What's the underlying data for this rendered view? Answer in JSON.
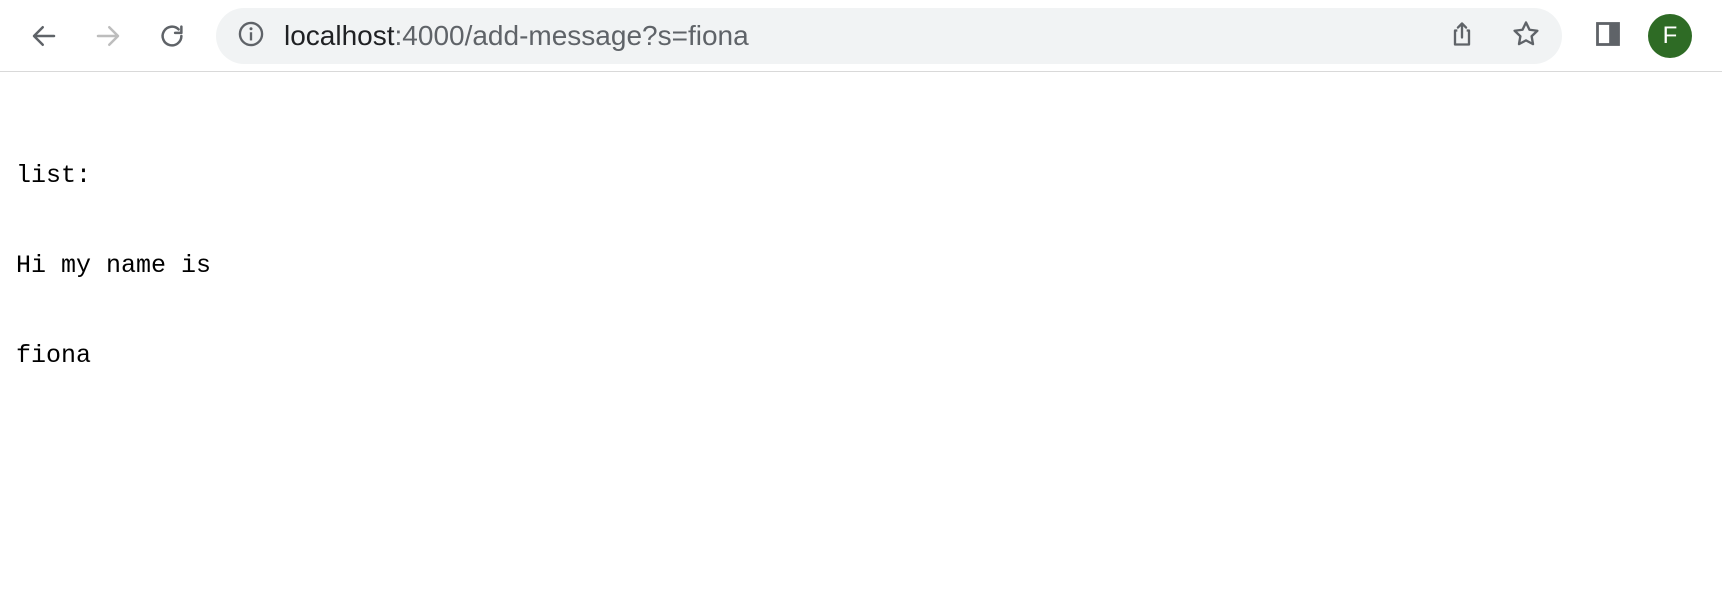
{
  "browser": {
    "nav": {
      "back_icon": "arrow-left-icon",
      "forward_icon": "arrow-right-icon",
      "reload_icon": "reload-icon"
    },
    "omnibox": {
      "info_icon": "info-circle-icon",
      "url_host": "localhost",
      "url_rest": ":4000/add-message?s=fiona",
      "share_icon": "share-icon",
      "bookmark_icon": "star-icon"
    },
    "side_panel_icon": "side-panel-icon",
    "profile": {
      "initial": "F",
      "color": "#2e6b25"
    }
  },
  "page": {
    "lines": [
      "list:",
      "Hi my name is",
      "fiona"
    ]
  }
}
